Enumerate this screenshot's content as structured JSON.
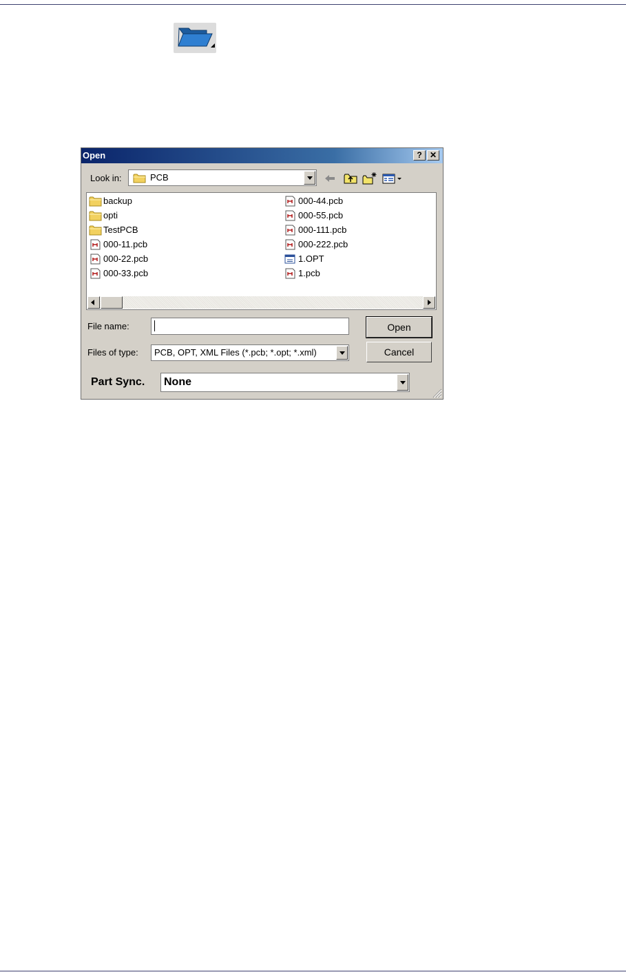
{
  "dialog": {
    "title": "Open",
    "help_label": "?",
    "close_label": "✕",
    "look_in": {
      "label": "Look in:",
      "value": "PCB"
    },
    "toolbar": [
      "back-icon",
      "up-folder-icon",
      "new-folder-icon",
      "views-menu-icon"
    ],
    "files_left": [
      {
        "name": "backup",
        "icon": "folder-icon"
      },
      {
        "name": "opti",
        "icon": "folder-icon"
      },
      {
        "name": "TestPCB",
        "icon": "folder-icon"
      },
      {
        "name": "000-11.pcb",
        "icon": "pcb-file-icon"
      },
      {
        "name": "000-22.pcb",
        "icon": "pcb-file-icon"
      },
      {
        "name": "000-33.pcb",
        "icon": "pcb-file-icon"
      }
    ],
    "files_right": [
      {
        "name": "000-44.pcb",
        "icon": "pcb-file-icon"
      },
      {
        "name": "000-55.pcb",
        "icon": "pcb-file-icon"
      },
      {
        "name": "000-111.pcb",
        "icon": "pcb-file-icon"
      },
      {
        "name": "000-222.pcb",
        "icon": "pcb-file-icon"
      },
      {
        "name": "1.OPT",
        "icon": "opt-file-icon"
      },
      {
        "name": "1.pcb",
        "icon": "pcb-file-icon"
      }
    ],
    "file_name": {
      "label": "File name:",
      "value": ""
    },
    "files_of_type": {
      "label": "Files of type:",
      "value": "PCB, OPT, XML Files (*.pcb; *.opt; *.xml)"
    },
    "open_button": "Open",
    "cancel_button": "Cancel",
    "part_sync": {
      "label": "Part Sync.",
      "value": "None"
    }
  },
  "colors": {
    "title_bar": "#0a246a",
    "dialog_face": "#d4d0c8",
    "folder": "#f2d15f",
    "toolbar_folder_blue": "#2f7fd1"
  }
}
